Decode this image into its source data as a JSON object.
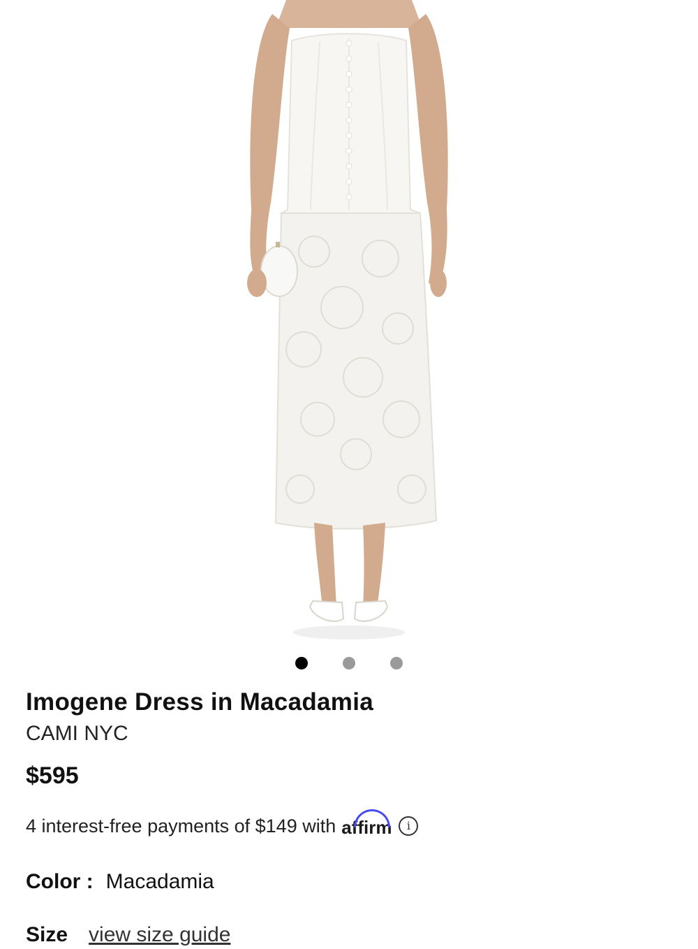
{
  "product": {
    "title": "Imogene Dress in Macadamia",
    "brand": "CAMI NYC",
    "price": "$595",
    "payments_text": "4 interest-free payments of $149 with",
    "payment_provider": "affirm",
    "info_icon_glyph": "i",
    "color_label": "Color :",
    "color_value": "Macadamia",
    "size_label": "Size",
    "size_guide_link": "view size guide"
  },
  "carousel": {
    "total": 3,
    "active_index": 0
  },
  "icons": {
    "info": "info-circle-icon",
    "affirm": "affirm-logo"
  },
  "colors": {
    "affirm_accent": "#4a4af4",
    "dot_active": "#000000",
    "dot_inactive": "#9a9a9a"
  }
}
